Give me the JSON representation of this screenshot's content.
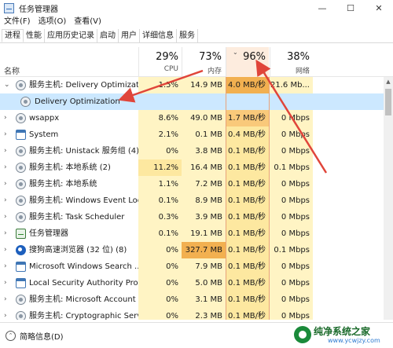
{
  "window": {
    "title": "任务管理器",
    "minimize": "—",
    "maximize": "☐",
    "close": "✕"
  },
  "menu": [
    "文件(F)",
    "选项(O)",
    "查看(V)"
  ],
  "tabs": [
    "进程",
    "性能",
    "应用历史记录",
    "启动",
    "用户",
    "详细信息",
    "服务"
  ],
  "header": {
    "name_label": "名称",
    "cpu": {
      "pct": "29%",
      "label": "CPU"
    },
    "memory": {
      "pct": "73%",
      "label": "内存"
    },
    "disk": {
      "pct": "96%",
      "label": "磁"
    },
    "network": {
      "pct": "38%",
      "label": "网络"
    }
  },
  "rows": [
    {
      "name": "服务主机: Delivery Optimizatio...",
      "cpu": "1.5%",
      "mem": "14.9 MB",
      "disk": "4.0 MB/秒",
      "net": "21.6 Mb...",
      "icon": "gear-icon",
      "expanded": true
    },
    {
      "name": "Delivery Optimization",
      "cpu": "",
      "mem": "",
      "disk": "",
      "net": "",
      "icon": "gear-icon",
      "child": true,
      "selected": true
    },
    {
      "name": "wsappx",
      "cpu": "8.6%",
      "mem": "49.0 MB",
      "disk": "1.7 MB/秒",
      "net": "0 Mbps",
      "icon": "gear-icon"
    },
    {
      "name": "System",
      "cpu": "2.1%",
      "mem": "0.1 MB",
      "disk": "0.4 MB/秒",
      "net": "0 Mbps",
      "icon": "window-icon"
    },
    {
      "name": "服务主机: Unistack 服务组 (4)",
      "cpu": "0%",
      "mem": "3.8 MB",
      "disk": "0.1 MB/秒",
      "net": "0 Mbps",
      "icon": "gear-icon"
    },
    {
      "name": "服务主机: 本地系统 (2)",
      "cpu": "11.2%",
      "mem": "16.4 MB",
      "disk": "0.1 MB/秒",
      "net": "0.1 Mbps",
      "icon": "gear-icon"
    },
    {
      "name": "服务主机: 本地系统",
      "cpu": "1.1%",
      "mem": "7.2 MB",
      "disk": "0.1 MB/秒",
      "net": "0 Mbps",
      "icon": "gear-icon"
    },
    {
      "name": "服务主机: Windows Event Log",
      "cpu": "0.1%",
      "mem": "8.9 MB",
      "disk": "0.1 MB/秒",
      "net": "0 Mbps",
      "icon": "gear-icon"
    },
    {
      "name": "服务主机: Task Scheduler",
      "cpu": "0.3%",
      "mem": "3.9 MB",
      "disk": "0.1 MB/秒",
      "net": "0 Mbps",
      "icon": "gear-icon"
    },
    {
      "name": "任务管理器",
      "cpu": "0.1%",
      "mem": "19.1 MB",
      "disk": "0.1 MB/秒",
      "net": "0 Mbps",
      "icon": "task-manager-icon"
    },
    {
      "name": "搜狗高速浏览器 (32 位) (8)",
      "cpu": "0%",
      "mem": "327.7 MB",
      "disk": "0.1 MB/秒",
      "net": "0.1 Mbps",
      "icon": "browser-icon"
    },
    {
      "name": "Microsoft Windows Search ...",
      "cpu": "0%",
      "mem": "7.9 MB",
      "disk": "0.1 MB/秒",
      "net": "0 Mbps",
      "icon": "window-icon"
    },
    {
      "name": "Local Security Authority Proc...",
      "cpu": "0%",
      "mem": "5.0 MB",
      "disk": "0.1 MB/秒",
      "net": "0 Mbps",
      "icon": "window-icon"
    },
    {
      "name": "服务主机: Microsoft Account ...",
      "cpu": "0%",
      "mem": "3.1 MB",
      "disk": "0.1 MB/秒",
      "net": "0 Mbps",
      "icon": "gear-icon"
    },
    {
      "name": "服务主机: Cryptographic Serv...",
      "cpu": "0%",
      "mem": "2.3 MB",
      "disk": "0.1 MB/秒",
      "net": "0 Mbps",
      "icon": "gear-icon"
    }
  ],
  "footer": {
    "label": "简略信息(D)"
  },
  "watermark": {
    "title": "纯净系统之家",
    "url": "www.ycwjzy.com"
  },
  "colors": {
    "heat_low": "#fff4c4",
    "heat_mid": "#fde8a0",
    "heat_high": "#f9c97a",
    "heat_max": "#f2b050",
    "selected": "#cce8ff",
    "arrow": "#e0453a",
    "sorted_header": "#fdecde"
  }
}
